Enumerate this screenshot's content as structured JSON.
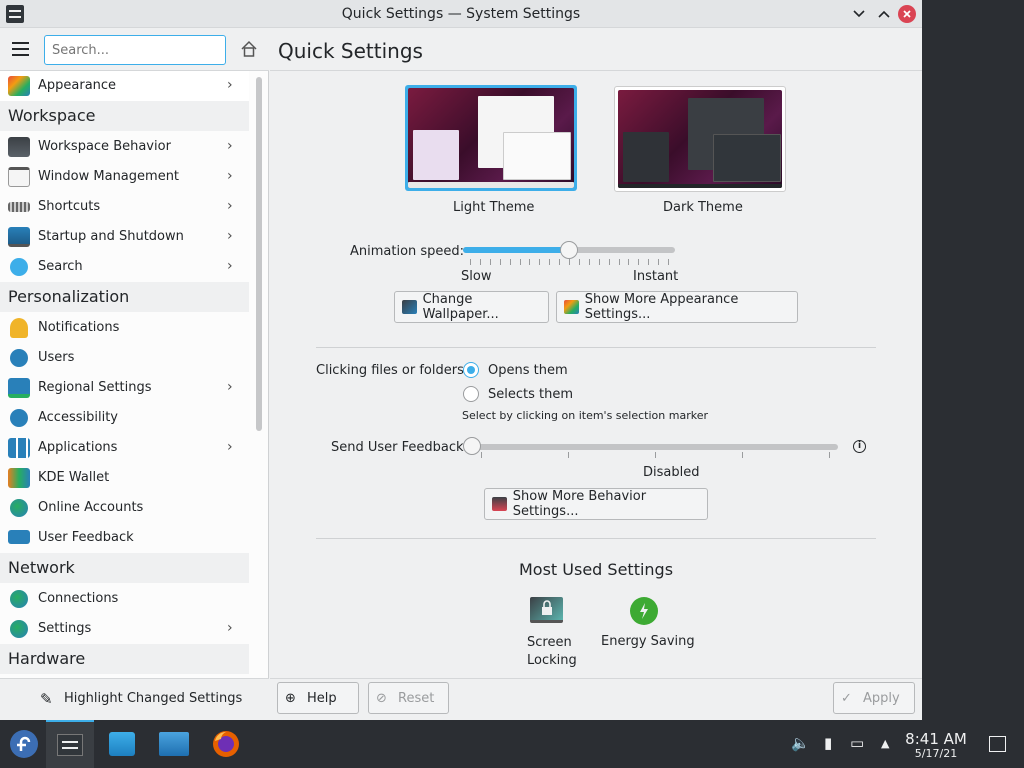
{
  "window": {
    "title": "Quick Settings — System Settings"
  },
  "sidebar": {
    "search_placeholder": "Search...",
    "items": [
      {
        "label": "Appearance",
        "chevron": true,
        "icon": "appearance-icon"
      },
      {
        "category": "Workspace"
      },
      {
        "label": "Workspace Behavior",
        "chevron": true,
        "icon": "workspace-behavior-icon"
      },
      {
        "label": "Window Management",
        "chevron": true,
        "icon": "window-management-icon"
      },
      {
        "label": "Shortcuts",
        "chevron": true,
        "icon": "keyboard-icon"
      },
      {
        "label": "Startup and Shutdown",
        "chevron": true,
        "icon": "monitor-icon"
      },
      {
        "label": "Search",
        "chevron": true,
        "icon": "search-icon"
      },
      {
        "category": "Personalization"
      },
      {
        "label": "Notifications",
        "chevron": false,
        "icon": "bell-icon"
      },
      {
        "label": "Users",
        "chevron": false,
        "icon": "users-icon"
      },
      {
        "label": "Regional Settings",
        "chevron": true,
        "icon": "regional-icon"
      },
      {
        "label": "Accessibility",
        "chevron": false,
        "icon": "accessibility-icon"
      },
      {
        "label": "Applications",
        "chevron": true,
        "icon": "applications-icon"
      },
      {
        "label": "KDE Wallet",
        "chevron": false,
        "icon": "wallet-icon"
      },
      {
        "label": "Online Accounts",
        "chevron": false,
        "icon": "globe-icon"
      },
      {
        "label": "User Feedback",
        "chevron": false,
        "icon": "feedback-icon"
      },
      {
        "category": "Network"
      },
      {
        "label": "Connections",
        "chevron": false,
        "icon": "globe-icon"
      },
      {
        "label": "Settings",
        "chevron": true,
        "icon": "globe-icon"
      },
      {
        "category": "Hardware"
      }
    ],
    "highlight_label": "Highlight Changed Settings"
  },
  "main": {
    "title": "Quick Settings",
    "themes": {
      "light": "Light Theme",
      "dark": "Dark Theme"
    },
    "animation": {
      "label": "Animation speed:",
      "min_label": "Slow",
      "max_label": "Instant",
      "value": 0.5
    },
    "change_wallpaper": "Change Wallpaper...",
    "more_appearance": "Show More Appearance Settings...",
    "clicking": {
      "label": "Clicking files or folders:",
      "opt_open": "Opens them",
      "opt_select": "Selects them",
      "hint": "Select by clicking on item's selection marker"
    },
    "feedback": {
      "label": "Send User Feedback:",
      "value_label": "Disabled",
      "value": 0
    },
    "more_behavior": "Show More Behavior Settings...",
    "most_used": {
      "title": "Most Used Settings",
      "items": [
        {
          "label": "Screen Locking"
        },
        {
          "label": "Energy Saving"
        }
      ]
    },
    "buttons": {
      "help": "Help",
      "reset": "Reset",
      "apply": "Apply"
    }
  },
  "clock": {
    "time": "8:41 AM",
    "date": "5/17/21"
  },
  "colors": {
    "accent": "#3daee9",
    "close": "#da4453",
    "taskbar": "#2b2e33"
  }
}
